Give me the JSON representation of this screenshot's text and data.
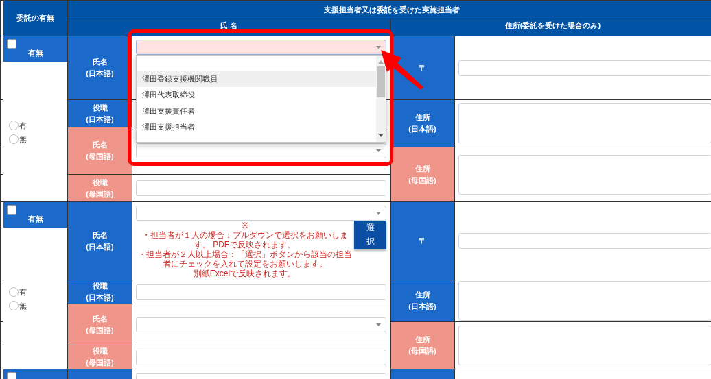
{
  "header": {
    "entrustment": "委託の有無",
    "group_title": "支援担当者又は委託を受けた実施担当者",
    "name_heading": "氏 名",
    "address_heading": "住所(委託を受けた場合のみ)"
  },
  "sections": [
    {
      "entrustment": {
        "checked": false,
        "label": "有無",
        "choices": [
          {
            "label": "有",
            "selected": false
          },
          {
            "label": "無",
            "selected": false
          }
        ]
      },
      "person_fields": [
        {
          "label": "氏名\n(日本語)",
          "color": "#1b6ac9",
          "kind": "select",
          "focused": true,
          "expanded": true,
          "options": [
            {
              "label": "澤田登録支援機関職員",
              "selected": true
            },
            {
              "label": "澤田代表取締役",
              "selected": false
            },
            {
              "label": "澤田支援責任者",
              "selected": false
            },
            {
              "label": "澤田支援担当者",
              "selected": false
            }
          ]
        },
        {
          "label": "役職\n(日本語)",
          "color": "#1b6ac9",
          "kind": "covered"
        },
        {
          "label": "氏名\n(母国語)",
          "color": "#ef958a",
          "kind": "select",
          "focused": false,
          "expanded": false
        },
        {
          "label": "役職\n(母国語)",
          "color": "#ef958a",
          "kind": "input"
        }
      ],
      "address_fields": [
        {
          "label": "〒",
          "color": "#1b6ac9",
          "kind": "input"
        },
        {
          "label": "住所\n(日本語)",
          "color": "#1b6ac9",
          "kind": "textarea"
        },
        {
          "label": "住所\n(母国語)",
          "color": "#ef958a",
          "kind": "textarea"
        }
      ]
    },
    {
      "entrustment": {
        "checked": false,
        "label": "有無",
        "choices": [
          {
            "label": "有",
            "selected": false
          },
          {
            "label": "無",
            "selected": false
          }
        ]
      },
      "person_fields": [
        {
          "label": "氏名\n(日本語)",
          "color": "#1b6ac9",
          "kind": "select",
          "focused": false,
          "expanded": false,
          "notes": [
            "※",
            "・担当者が１人の場合：プルダウンで選択をお願いします。 PDFで反映されます。",
            "・担当者が２人以上場合：「選択」ボタンから該当の担当者にチェックを入れて設定をお願いします。",
            "別紙Excelで反映されます。"
          ],
          "button": "選択"
        },
        {
          "label": "役職\n(日本語)",
          "color": "#1b6ac9",
          "kind": "input"
        },
        {
          "label": "氏名\n(母国語)",
          "color": "#ef958a",
          "kind": "select",
          "focused": false,
          "expanded": false
        },
        {
          "label": "役職\n(母国語)",
          "color": "#ef958a",
          "kind": "input"
        }
      ],
      "address_fields": [
        {
          "label": "〒",
          "color": "#1b6ac9",
          "kind": "input"
        },
        {
          "label": "住所\n(日本語)",
          "color": "#1b6ac9",
          "kind": "textarea"
        },
        {
          "label": "住所\n(母国語)",
          "color": "#ef958a",
          "kind": "textarea"
        }
      ]
    },
    {
      "entrustment": {
        "checked": false
      },
      "person_fields": [
        {
          "color": "#1b6ac9",
          "kind": "select",
          "focused": false,
          "expanded": false
        }
      ],
      "address_fields": [
        {
          "color": "#1b6ac9",
          "kind": "blank"
        }
      ]
    }
  ]
}
